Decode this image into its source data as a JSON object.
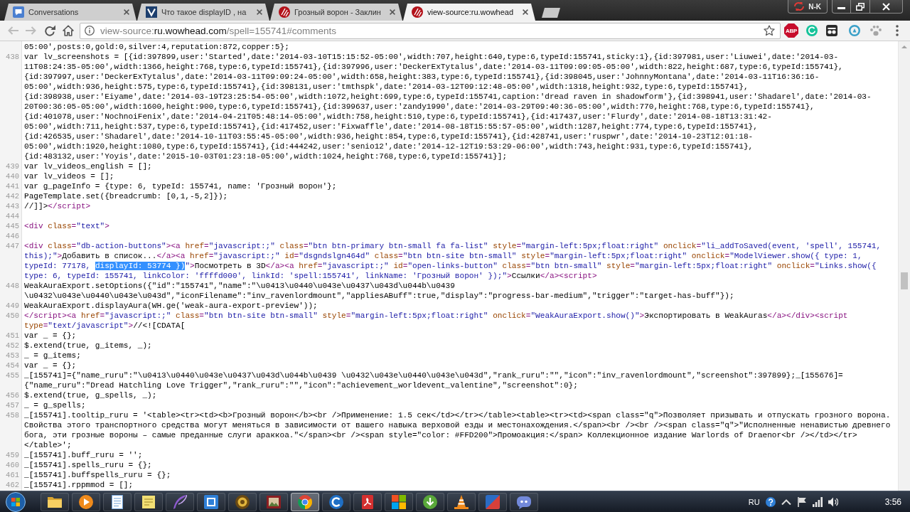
{
  "browser": {
    "tabs": [
      {
        "kind": "chat",
        "title": "Conversations",
        "selected": false
      },
      {
        "kind": "tile",
        "title": "Что такое displayID , на",
        "selected": false
      },
      {
        "kind": "claw",
        "title": "Грозный ворон - Заклин",
        "selected": false
      },
      {
        "kind": "claw",
        "title": "view-source:ru.wowhead",
        "selected": true
      }
    ],
    "profile": "N-K",
    "toolbar": {
      "buttons": [
        {
          "kind": "back",
          "disabled": true
        },
        {
          "kind": "forward",
          "disabled": true
        },
        {
          "kind": "reload",
          "disabled": false
        },
        {
          "kind": "home",
          "disabled": false
        }
      ],
      "address": [
        {
          "kind": "dim",
          "text": "view-source:"
        },
        {
          "kind": "host",
          "text": "ru.wowhead.com"
        },
        {
          "kind": "dim",
          "text": "/spell=155741#comments"
        }
      ],
      "extension_label": "ABP"
    }
  },
  "source": {
    "lines": [
      {
        "rows": [
          {
            "segments": [
              {
                "kind": "text",
                "text": "05:00',posts:0,gold:0,silver:4,reputation:872,copper:5};"
              }
            ]
          }
        ]
      },
      {
        "number": "438",
        "rows": [
          {
            "segments": [
              {
                "kind": "text",
                "text": "var lv_screenshots = [{id:397899,user:'Started',date:'2014-03-10T15:15:52-05:00',width:707,height:640,type:6,typeId:155741,sticky:1},{id:397981,user:'Liuwei',date:'2014-03-"
              }
            ]
          },
          {
            "segments": [
              {
                "kind": "text",
                "text": "11T08:24:35-05:00',width:1366,height:768,type:6,typeId:155741},{id:397996,user:'DeckerExTytalus',date:'2014-03-11T09:09:05-05:00',width:822,height:687,type:6,typeId:155741},"
              }
            ]
          },
          {
            "segments": [
              {
                "kind": "text",
                "text": "{id:397997,user:'DeckerExTytalus',date:'2014-03-11T09:09:24-05:00',width:658,height:383,type:6,typeId:155741},{id:398045,user:'JohnnyMontana',date:'2014-03-11T16:36:16-"
              }
            ]
          },
          {
            "segments": [
              {
                "kind": "text",
                "text": "05:00',width:936,height:575,type:6,typeId:155741},{id:398131,user:'tmthspk',date:'2014-03-12T09:12:48-05:00',width:1318,height:932,type:6,typeId:155741},"
              }
            ]
          },
          {
            "segments": [
              {
                "kind": "text",
                "text": "{id:398938,user:'Eiyame',date:'2014-03-19T23:25:54-05:00',width:1072,height:699,type:6,typeId:155741,caption:'dread raven in shadowform'},{id:398941,user:'Shadarel',date:'2014-03-"
              }
            ]
          },
          {
            "segments": [
              {
                "kind": "text",
                "text": "20T00:36:05-05:00',width:1600,height:900,type:6,typeId:155741},{id:399637,user:'zandy1990',date:'2014-03-29T09:40:36-05:00',width:770,height:768,type:6,typeId:155741},"
              }
            ]
          },
          {
            "segments": [
              {
                "kind": "text",
                "text": "{id:401078,user:'NochnoiFenix',date:'2014-04-21T05:48:14-05:00',width:758,height:510,type:6,typeId:155741},{id:417437,user:'Flurdy',date:'2014-08-18T13:31:42-"
              }
            ]
          },
          {
            "segments": [
              {
                "kind": "text",
                "text": "05:00',width:711,height:537,type:6,typeId:155741},{id:417452,user:'Fixwaffle',date:'2014-08-18T15:55:57-05:00',width:1287,height:774,type:6,typeId:155741},"
              }
            ]
          },
          {
            "segments": [
              {
                "kind": "text",
                "text": "{id:426535,user:'Shadarel',date:'2014-10-11T03:55:45-05:00',width:936,height:854,type:6,typeId:155741},{id:428741,user:'ruspwr',date:'2014-10-23T12:01:18-"
              }
            ]
          },
          {
            "segments": [
              {
                "kind": "text",
                "text": "05:00',width:1920,height:1080,type:6,typeId:155741},{id:444242,user:'senio12',date:'2014-12-12T19:53:29-06:00',width:743,height:931,type:6,typeId:155741},"
              }
            ]
          },
          {
            "segments": [
              {
                "kind": "text",
                "text": "{id:483132,user:'Yoyis',date:'2015-10-03T01:23:18-05:00',width:1024,height:768,type:6,typeId:155741}];"
              }
            ]
          }
        ]
      },
      {
        "number": "439",
        "rows": [
          {
            "segments": [
              {
                "kind": "text",
                "text": "var lv_videos_english = [];"
              }
            ]
          }
        ]
      },
      {
        "number": "440",
        "rows": [
          {
            "segments": [
              {
                "kind": "text",
                "text": "var lv_videos = [];"
              }
            ]
          }
        ]
      },
      {
        "number": "441",
        "rows": [
          {
            "segments": [
              {
                "kind": "text",
                "text": "var g_pageInfo = {type: 6, typeId: 155741, name: 'Грозный ворон'};"
              }
            ]
          }
        ]
      },
      {
        "number": "442",
        "rows": [
          {
            "segments": [
              {
                "kind": "text",
                "text": "PageTemplate.set({breadcrumb: [0,1,-5,2]});"
              }
            ]
          }
        ]
      },
      {
        "number": "443",
        "rows": [
          {
            "segments": [
              {
                "kind": "text",
                "text": "//]]>"
              },
              {
                "kind": "tag",
                "text": "</script>"
              }
            ]
          }
        ]
      },
      {
        "number": "444"
      },
      {
        "number": "445",
        "rows": [
          {
            "segments": [
              {
                "kind": "tag",
                "text": "<div"
              },
              {
                "kind": "attr",
                "text": " class"
              },
              {
                "kind": "tag",
                "text": "="
              },
              {
                "kind": "value",
                "text": "\"text\""
              },
              {
                "kind": "tag",
                "text": ">"
              }
            ]
          }
        ]
      },
      {
        "number": "446"
      },
      {
        "number": "447",
        "rows": [
          {
            "segments": [
              {
                "kind": "tag",
                "text": "<div"
              },
              {
                "kind": "attr",
                "text": " class"
              },
              {
                "kind": "tag",
                "text": "="
              },
              {
                "kind": "value",
                "text": "\"db-action-buttons\""
              },
              {
                "kind": "tag",
                "text": "><a"
              },
              {
                "kind": "attr",
                "text": " href"
              },
              {
                "kind": "tag",
                "text": "="
              },
              {
                "kind": "value",
                "text": "\"javascript:;\""
              },
              {
                "kind": "attr",
                "text": " class"
              },
              {
                "kind": "tag",
                "text": "="
              },
              {
                "kind": "value",
                "text": "\"btn btn-primary btn-small fa fa-list\""
              },
              {
                "kind": "attr",
                "text": " style"
              },
              {
                "kind": "tag",
                "text": "="
              },
              {
                "kind": "value",
                "text": "\"margin-left:5px;float:right\""
              },
              {
                "kind": "attr",
                "text": " onclick"
              },
              {
                "kind": "tag",
                "text": "="
              },
              {
                "kind": "value",
                "text": "\"li_addToSaved(event, 'spell', 155741,"
              }
            ]
          },
          {
            "segments": [
              {
                "kind": "value",
                "text": "this);\""
              },
              {
                "kind": "tag",
                "text": ">"
              },
              {
                "kind": "text",
                "text": "Добавить в список..."
              },
              {
                "kind": "tag",
                "text": "</a><a"
              },
              {
                "kind": "attr",
                "text": " href"
              },
              {
                "kind": "tag",
                "text": "="
              },
              {
                "kind": "value",
                "text": "\"javascript:;\""
              },
              {
                "kind": "attr",
                "text": " id"
              },
              {
                "kind": "tag",
                "text": "="
              },
              {
                "kind": "value",
                "text": "\"dsgndslgn464d\""
              },
              {
                "kind": "attr",
                "text": " class"
              },
              {
                "kind": "tag",
                "text": "="
              },
              {
                "kind": "value",
                "text": "\"btn btn-site btn-small\""
              },
              {
                "kind": "attr",
                "text": " style"
              },
              {
                "kind": "tag",
                "text": "="
              },
              {
                "kind": "value",
                "text": "\"margin-left:5px;float:right\""
              },
              {
                "kind": "attr",
                "text": " onclick"
              },
              {
                "kind": "tag",
                "text": "="
              },
              {
                "kind": "value",
                "text": "\"ModelViewer.show({ type: 1,"
              }
            ]
          },
          {
            "segments": [
              {
                "kind": "value",
                "text": "typeId: 77178, "
              },
              {
                "kind": "selection",
                "text": "displayId: 53774 })"
              },
              {
                "kind": "value",
                "text": "\""
              },
              {
                "kind": "tag",
                "text": ">"
              },
              {
                "kind": "text",
                "text": "Посмотреть в 3D"
              },
              {
                "kind": "tag",
                "text": "</a><a"
              },
              {
                "kind": "attr",
                "text": " href"
              },
              {
                "kind": "tag",
                "text": "="
              },
              {
                "kind": "value",
                "text": "\"javascript:;\""
              },
              {
                "kind": "attr",
                "text": " id"
              },
              {
                "kind": "tag",
                "text": "="
              },
              {
                "kind": "value",
                "text": "\"open-links-button\""
              },
              {
                "kind": "attr",
                "text": " class"
              },
              {
                "kind": "tag",
                "text": "="
              },
              {
                "kind": "value",
                "text": "\"btn btn-small\""
              },
              {
                "kind": "attr",
                "text": " style"
              },
              {
                "kind": "tag",
                "text": "="
              },
              {
                "kind": "value",
                "text": "\"margin-left:5px;float:right\""
              },
              {
                "kind": "attr",
                "text": " onclick"
              },
              {
                "kind": "tag",
                "text": "="
              },
              {
                "kind": "value",
                "text": "\"Links.show({"
              }
            ]
          },
          {
            "segments": [
              {
                "kind": "value",
                "text": "type: 6, typeId: 155741, linkColor: 'ffffd000', linkId: 'spell:155741', linkName: 'Грозный ворон' });\""
              },
              {
                "kind": "tag",
                "text": ">"
              },
              {
                "kind": "text",
                "text": "Ссылки"
              },
              {
                "kind": "tag",
                "text": "</a><script>"
              }
            ]
          }
        ]
      },
      {
        "number": "448",
        "rows": [
          {
            "segments": [
              {
                "kind": "text",
                "text": "WeakAuraExport.setOptions({\"id\":\"155741\",\"name\":\"\\u0413\\u0440\\u043e\\u0437\\u043d\\u044b\\u0439"
              }
            ]
          },
          {
            "segments": [
              {
                "kind": "text",
                "text": "\\u0432\\u043e\\u0440\\u043e\\u043d\",\"iconFilename\":\"inv_ravenlordmount\",\"appliesABuff\":true,\"display\":\"progress-bar-medium\",\"trigger\":\"target-has-buff\"});"
              }
            ]
          }
        ]
      },
      {
        "number": "449",
        "rows": [
          {
            "segments": [
              {
                "kind": "text",
                "text": "WeakAuraExport.displayAura(WH.ge('weak-aura-export-preview'));"
              }
            ]
          }
        ]
      },
      {
        "number": "450",
        "rows": [
          {
            "segments": [
              {
                "kind": "tag",
                "text": "</script><a"
              },
              {
                "kind": "attr",
                "text": " href"
              },
              {
                "kind": "tag",
                "text": "="
              },
              {
                "kind": "value",
                "text": "\"javascript:;\""
              },
              {
                "kind": "attr",
                "text": " class"
              },
              {
                "kind": "tag",
                "text": "="
              },
              {
                "kind": "value",
                "text": "\"btn btn-site btn-small\""
              },
              {
                "kind": "attr",
                "text": " style"
              },
              {
                "kind": "tag",
                "text": "="
              },
              {
                "kind": "value",
                "text": "\"margin-left:5px;float:right\""
              },
              {
                "kind": "attr",
                "text": " onclick"
              },
              {
                "kind": "tag",
                "text": "="
              },
              {
                "kind": "value",
                "text": "\"WeakAuraExport.show()\""
              },
              {
                "kind": "tag",
                "text": ">"
              },
              {
                "kind": "text",
                "text": "Экспортировать в WeakAuras"
              },
              {
                "kind": "tag",
                "text": "</a></div><script"
              }
            ]
          },
          {
            "segments": [
              {
                "kind": "attr",
                "text": "type"
              },
              {
                "kind": "tag",
                "text": "="
              },
              {
                "kind": "value",
                "text": "\"text/javascript\""
              },
              {
                "kind": "tag",
                "text": ">"
              },
              {
                "kind": "text",
                "text": "//<![CDATA["
              }
            ]
          }
        ]
      },
      {
        "number": "451",
        "rows": [
          {
            "segments": [
              {
                "kind": "text",
                "text": "var _ = {};"
              }
            ]
          }
        ]
      },
      {
        "number": "452",
        "rows": [
          {
            "segments": [
              {
                "kind": "text",
                "text": "$.extend(true, g_items, _);"
              }
            ]
          }
        ]
      },
      {
        "number": "453",
        "rows": [
          {
            "segments": [
              {
                "kind": "text",
                "text": "_ = g_items;"
              }
            ]
          }
        ]
      },
      {
        "number": "454",
        "rows": [
          {
            "segments": [
              {
                "kind": "text",
                "text": "var _ = {};"
              }
            ]
          }
        ]
      },
      {
        "number": "455",
        "rows": [
          {
            "segments": [
              {
                "kind": "text",
                "text": "_[155741]={\"name_ruru\":\"\\u0413\\u0440\\u043e\\u0437\\u043d\\u044b\\u0439 \\u0432\\u043e\\u0440\\u043e\\u043d\",\"rank_ruru\":\"\",\"icon\":\"inv_ravenlordmount\",\"screenshot\":397899};_[155676]="
              }
            ]
          },
          {
            "segments": [
              {
                "kind": "text",
                "text": "{\"name_ruru\":\"Dread Hatchling Love Trigger\",\"rank_ruru\":\"\",\"icon\":\"achievement_worldevent_valentine\",\"screenshot\":0};"
              }
            ]
          }
        ]
      },
      {
        "number": "456",
        "rows": [
          {
            "segments": [
              {
                "kind": "text",
                "text": "$.extend(true, g_spells, _);"
              }
            ]
          }
        ]
      },
      {
        "number": "457",
        "rows": [
          {
            "segments": [
              {
                "kind": "text",
                "text": "_ = g_spells;"
              }
            ]
          }
        ]
      },
      {
        "number": "458",
        "rows": [
          {
            "segments": [
              {
                "kind": "text",
                "text": "_[155741].tooltip_ruru = '<table><tr><td><b>Грозный ворон</b><br />Применение: 1.5 сек</td></tr></table><table><tr><td><span class=\"q\">Позволяет призывать и отпускать грозного ворона."
              }
            ]
          },
          {
            "segments": [
              {
                "kind": "text",
                "text": "Свойства этого транспортного средства могут меняться в зависимости от вашего навыка верховой езды и местонахождения.</span><br /><br /><span class=\"q\">\"Исполненные ненавистью древнего"
              }
            ]
          },
          {
            "segments": [
              {
                "kind": "text",
                "text": "бога, эти грозные вороны – самые преданные слуги араккоа.\"</span><br /><span style=\"color: #FFD200\">Промоакция:</span> Коллекционное издание Warlords of Draenor<br /></td></tr>"
              }
            ]
          },
          {
            "segments": [
              {
                "kind": "text",
                "text": "</table>';"
              }
            ]
          }
        ]
      },
      {
        "number": "459",
        "rows": [
          {
            "segments": [
              {
                "kind": "text",
                "text": "_[155741].buff_ruru = '';"
              }
            ]
          }
        ]
      },
      {
        "number": "460",
        "rows": [
          {
            "segments": [
              {
                "kind": "text",
                "text": "_[155741].spells_ruru = {};"
              }
            ]
          }
        ]
      },
      {
        "number": "461",
        "rows": [
          {
            "segments": [
              {
                "kind": "text",
                "text": "_[155741].buffspells_ruru = {};"
              }
            ]
          }
        ]
      },
      {
        "number": "462",
        "rows": [
          {
            "segments": [
              {
                "kind": "text",
                "text": "_[155741].rppmmod = [];"
              }
            ]
          }
        ]
      }
    ]
  },
  "taskbar": {
    "apps": [
      {
        "kind": "folder",
        "active": false
      },
      {
        "kind": "player",
        "active": false
      },
      {
        "kind": "notepad",
        "active": false
      },
      {
        "kind": "note",
        "active": false
      },
      {
        "kind": "feather",
        "active": false
      },
      {
        "kind": "tile",
        "active": false
      },
      {
        "kind": "emblem",
        "active": false
      },
      {
        "kind": "picture",
        "active": false
      },
      {
        "kind": "browser",
        "active": true
      },
      {
        "kind": "arc",
        "active": false
      },
      {
        "kind": "document",
        "active": false
      },
      {
        "kind": "tiles",
        "active": false
      },
      {
        "kind": "download",
        "active": false
      },
      {
        "kind": "cone",
        "active": false
      },
      {
        "kind": "split",
        "active": false
      },
      {
        "kind": "bubble",
        "active": false
      }
    ],
    "language": "RU",
    "clock": "3:56"
  }
}
